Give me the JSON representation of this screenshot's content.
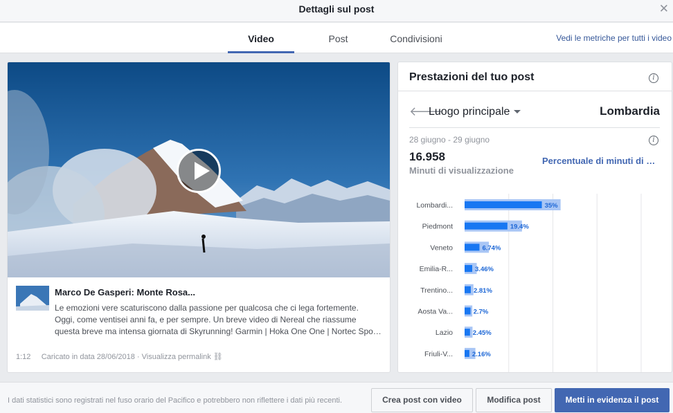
{
  "dialog": {
    "title": "Dettagli sul post",
    "close_icon": "close-icon"
  },
  "tabs": [
    {
      "label": "Video",
      "active": true
    },
    {
      "label": "Post",
      "active": false
    },
    {
      "label": "Condivisioni",
      "active": false
    }
  ],
  "metrics_link": "Vedi le metriche per tutti i video",
  "video": {
    "title": "Marco De Gasperi: Monte Rosa...",
    "description_lines": [
      "Le emozioni vere scaturiscono dalla passione per qualcosa che ci lega fortemente.",
      "Oggi, come ventisei anni fa, e per sempre. Un breve video di Nereal che riassume",
      "questa breve ma intensa giornata di Skyrunning! Garmin | Hoka One One | Nortec Spo…"
    ],
    "duration": "1:12",
    "uploaded": "Caricato in data 28/06/2018",
    "separator": "·",
    "permalink": "Visualizza permalink"
  },
  "performance": {
    "title": "Prestazioni del tuo post",
    "location_label": "Luogo principale",
    "location_value": "Lombardia",
    "date_range": "28 giugno - 29 giugno",
    "total": "16.958",
    "total_label": "Minuti di visualizzazione",
    "percent_link": "Percentuale di minuti di visualizzazione"
  },
  "chart_data": {
    "type": "bar",
    "orientation": "horizontal",
    "categories": [
      "Lombardi...",
      "Piedmont",
      "Veneto",
      "Emilia-R...",
      "Trentino...",
      "Aosta Va...",
      "Lazio",
      "Friuli-V..."
    ],
    "series": [
      {
        "values": [
          35,
          19.4,
          6.74,
          3.46,
          2.81,
          2.7,
          2.45,
          2.16
        ]
      },
      {
        "values": [
          43.5,
          26,
          11,
          5.5,
          4,
          3.5,
          3.6,
          4.9
        ]
      }
    ],
    "labels": [
      "35%",
      "19.4%",
      "6.74%",
      "3.46%",
      "2.81%",
      "2.7%",
      "2.45%",
      "2.16%"
    ],
    "xlim": [
      0,
      80
    ],
    "colors": {
      "primary": "#1877f2",
      "secondary": "#a9c6f5",
      "label": "#1d67d6"
    }
  },
  "footer": {
    "note": "I dati statistici sono registrati nel fuso orario del Pacifico e potrebbero non riflettere i dati più recenti.",
    "buttons": {
      "create": "Crea post con video",
      "edit": "Modifica post",
      "boost": "Metti in evidenza il post"
    }
  }
}
